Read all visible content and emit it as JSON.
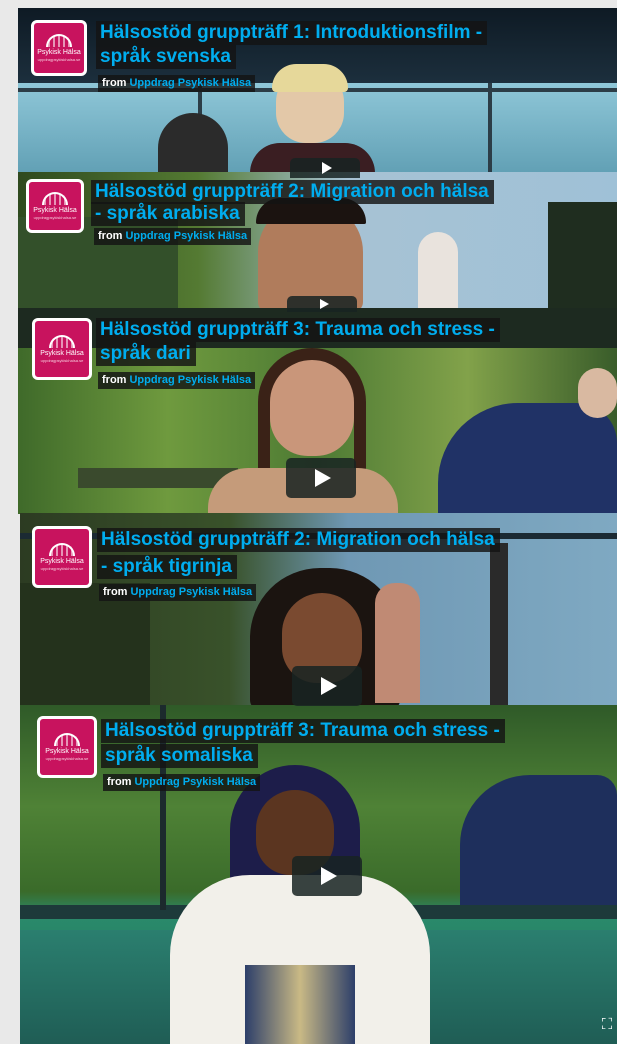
{
  "videos": [
    {
      "title_line1": "Hälsostöd gruppträff 1: Introduktionsfilm -",
      "title_line2": "språk svenska",
      "from": "from",
      "channel": "Uppdrag Psykisk Hälsa",
      "logo_text": "Psykisk Hälsa",
      "logo_sub": "uppdragpsykiskhalsa.se"
    },
    {
      "title_line1": "Hälsostöd gruppträff 2: Migration och hälsa",
      "title_line2": "- språk arabiska",
      "from": "from",
      "channel": "Uppdrag Psykisk Hälsa",
      "logo_text": "Psykisk Hälsa",
      "logo_sub": "uppdragpsykiskhalsa.se"
    },
    {
      "title_line1": "Hälsostöd gruppträff 3: Trauma och stress -",
      "title_line2": "språk dari",
      "from": "from",
      "channel": "Uppdrag Psykisk Hälsa",
      "logo_text": "Psykisk Hälsa",
      "logo_sub": "uppdragpsykiskhalsa.se"
    },
    {
      "title_line1": "Hälsostöd gruppträff 2: Migration och hälsa",
      "title_line2": "- språk tigrinja",
      "from": "from",
      "channel": "Uppdrag Psykisk Hälsa",
      "logo_text": "Psykisk Hälsa",
      "logo_sub": "uppdragpsykiskhalsa.se"
    },
    {
      "title_line1": "Hälsostöd gruppträff 3: Trauma och stress -",
      "title_line2": "språk somaliska",
      "from": "from",
      "channel": "Uppdrag Psykisk Hälsa",
      "logo_text": "Psykisk Hälsa",
      "logo_sub": "uppdragpsykiskhalsa.se"
    }
  ],
  "icons": {
    "play": "play-icon",
    "fullscreen": "fullscreen-icon"
  },
  "colors": {
    "title": "#00adef",
    "logo_bg": "#c8135e",
    "overlay_bg": "#141414",
    "page_bg": "#e9e9e9"
  }
}
